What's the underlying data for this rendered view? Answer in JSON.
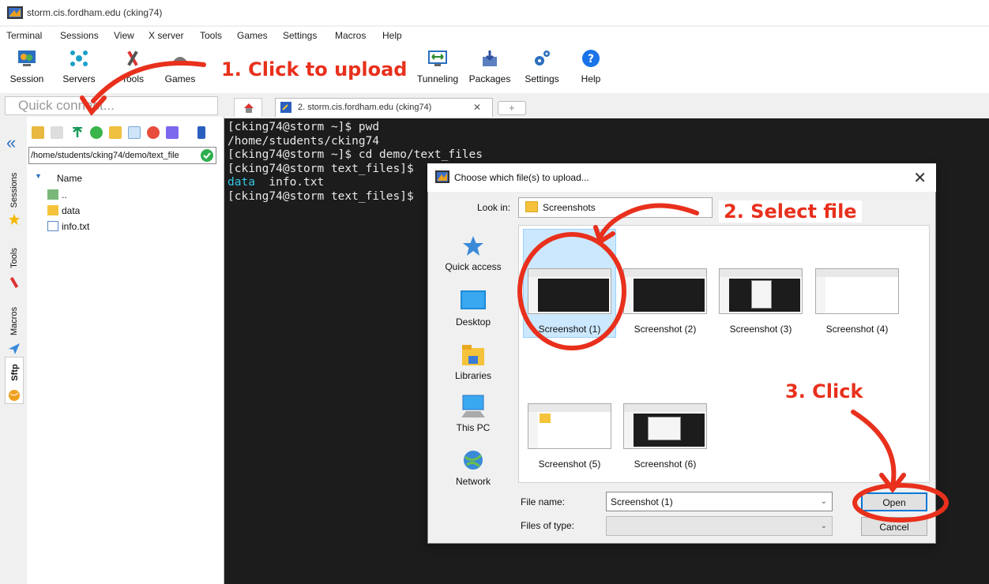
{
  "window": {
    "title": "storm.cis.fordham.edu (cking74)"
  },
  "menu": [
    "Terminal",
    "Sessions",
    "View",
    "X server",
    "Tools",
    "Games",
    "Settings",
    "Macros",
    "Help"
  ],
  "toolbar": {
    "session": "Session",
    "servers": "Servers",
    "tools": "Tools",
    "games": "Games",
    "tunneling": "Tunneling",
    "packages": "Packages",
    "settings": "Settings",
    "help": "Help"
  },
  "quick_connect": {
    "placeholder": "Quick connect..."
  },
  "side_tabs": {
    "sessions": "Sessions",
    "tools": "Tools",
    "macros": "Macros",
    "sftp": "Sftp"
  },
  "sftp": {
    "path": "/home/students/cking74/demo/text_file",
    "column_name": "Name",
    "files": [
      {
        "name": "..",
        "icon": "parent-folder-icon"
      },
      {
        "name": "data",
        "icon": "folder-icon"
      },
      {
        "name": "info.txt",
        "icon": "text-file-icon"
      }
    ]
  },
  "tabs": {
    "session_tab": "2. storm.cis.fordham.edu (cking74)"
  },
  "terminal": {
    "lines": [
      "[cking74@storm ~]$ pwd",
      "/home/students/cking74",
      "[cking74@storm ~]$ cd demo/text_files",
      "[cking74@storm text_files]$",
      "",
      "[cking74@storm text_files]$"
    ],
    "ls_dir": "data",
    "ls_file": "info.txt"
  },
  "dialog": {
    "title": "Choose which file(s) to upload...",
    "look_in_label": "Look in:",
    "look_in_value": "Screenshots",
    "places": [
      "Quick access",
      "Desktop",
      "Libraries",
      "This PC",
      "Network"
    ],
    "files": [
      "Screenshot (1)",
      "Screenshot (2)",
      "Screenshot (3)",
      "Screenshot (4)",
      "Screenshot (5)",
      "Screenshot (6)"
    ],
    "selected_file": "Screenshot (1)",
    "file_name_label": "File name:",
    "file_name_value": "Screenshot (1)",
    "file_type_label": "Files of type:",
    "file_type_value": "",
    "open_button": "Open",
    "cancel_button": "Cancel"
  },
  "annotations": {
    "step1": "1. Click to upload",
    "step2": "2. Select file",
    "step3": "3. Click",
    "color": "#e8301c"
  }
}
